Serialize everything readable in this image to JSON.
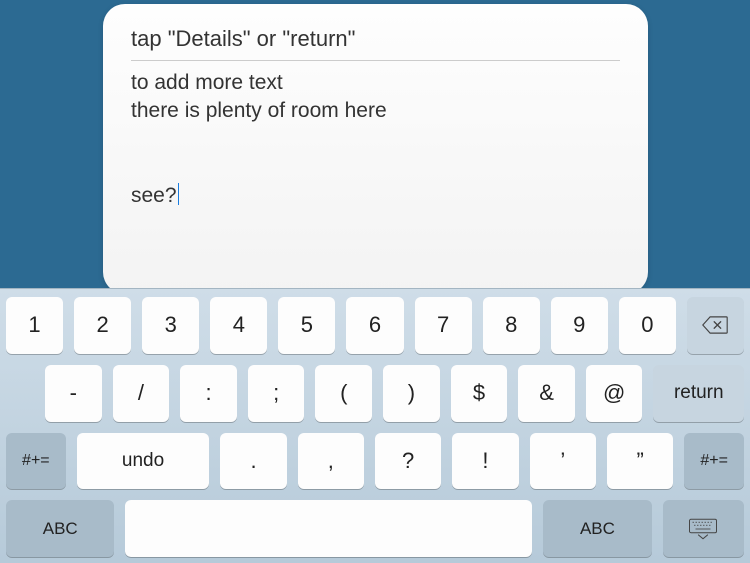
{
  "card": {
    "title": "tap \"Details\" or \"return\"",
    "body": "to add more text\nthere is plenty of room here\n\n\nsee?"
  },
  "keyboard": {
    "row1": [
      "1",
      "2",
      "3",
      "4",
      "5",
      "6",
      "7",
      "8",
      "9",
      "0"
    ],
    "row2": [
      "-",
      "/",
      ":",
      ";",
      "(",
      ")",
      "$",
      "&",
      "@"
    ],
    "row2_return": "return",
    "row3_symshift": "#+=",
    "row3_undo": "undo",
    "row3_punct": [
      ".",
      ",",
      "?",
      "!",
      "’",
      "”"
    ],
    "row4_abc": "ABC"
  }
}
